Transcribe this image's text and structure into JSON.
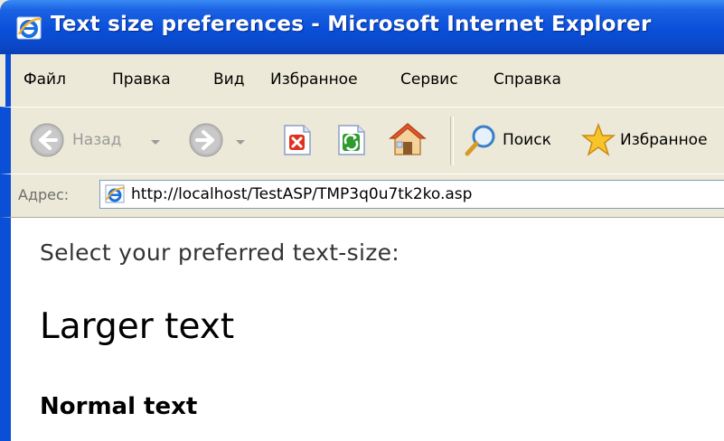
{
  "window": {
    "title": "Text size preferences - Microsoft Internet Explorer"
  },
  "menu": {
    "items": [
      "Файл",
      "Правка",
      "Вид",
      "Избранное",
      "Сервис",
      "Справка"
    ]
  },
  "toolbar": {
    "back_label": "Назад",
    "search_label": "Поиск",
    "favorites_label": "Избранное"
  },
  "address": {
    "label": "Адрес:",
    "url": "http://localhost/TestASP/TMP3q0u7tk2ko.asp"
  },
  "page": {
    "prompt": "Select your preferred text-size:",
    "larger_text": "Larger text",
    "normal_text": "Normal text"
  },
  "colors": {
    "titlebar": "#0a4fd9",
    "chrome": "#ece9d8",
    "content_bg": "#ffffff"
  }
}
